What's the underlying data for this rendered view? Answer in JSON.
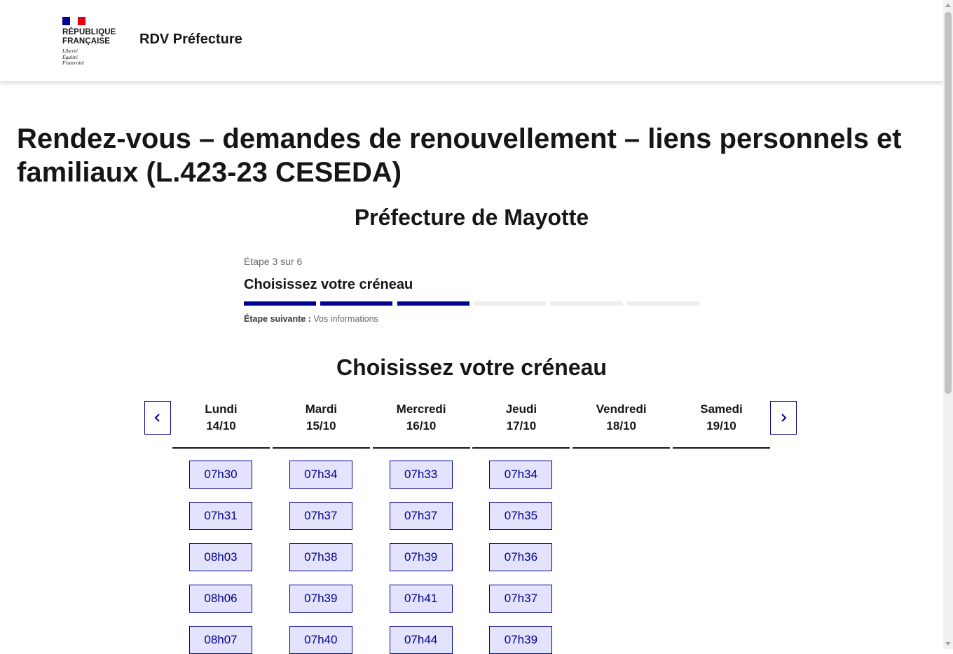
{
  "header": {
    "republic_name": "République\nFrançaise",
    "motto": "Liberté\nÉgalité\nFraternité",
    "service_title": "RDV Préfecture"
  },
  "page": {
    "title": "Rendez-vous – demandes de renouvellement – liens personnels et familiaux (L.423-23 CESEDA)",
    "prefecture": "Préfecture de Mayotte"
  },
  "stepper": {
    "state": "Étape 3 sur 6",
    "title": "Choisissez votre créneau",
    "current_step": 3,
    "total_steps": 6,
    "next_label": "Étape suivante :",
    "next_value": "Vos informations"
  },
  "slots_section": {
    "title": "Choisissez votre créneau",
    "prev_icon": "chevron-left-icon",
    "next_icon": "chevron-right-icon",
    "days": [
      {
        "name": "Lundi",
        "date": "14/10",
        "slots": [
          "07h30",
          "07h31",
          "08h03",
          "08h06",
          "08h07"
        ]
      },
      {
        "name": "Mardi",
        "date": "15/10",
        "slots": [
          "07h34",
          "07h37",
          "07h38",
          "07h39",
          "07h40"
        ]
      },
      {
        "name": "Mercredi",
        "date": "16/10",
        "slots": [
          "07h33",
          "07h37",
          "07h39",
          "07h41",
          "07h44"
        ]
      },
      {
        "name": "Jeudi",
        "date": "17/10",
        "slots": [
          "07h34",
          "07h35",
          "07h36",
          "07h37",
          "07h39"
        ]
      },
      {
        "name": "Vendredi",
        "date": "18/10",
        "slots": []
      },
      {
        "name": "Samedi",
        "date": "19/10",
        "slots": []
      }
    ]
  },
  "colors": {
    "brand_blue": "#000091",
    "slot_background": "#e3e3fd",
    "flag_red": "#e1000f",
    "step_inactive": "#eeeeee"
  }
}
